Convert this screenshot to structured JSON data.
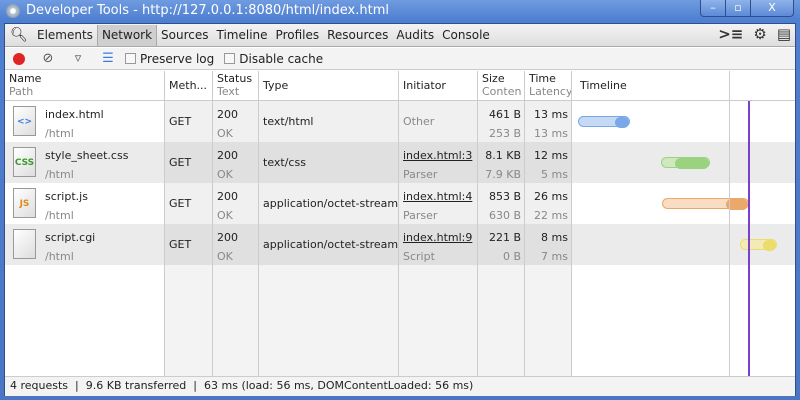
{
  "window": {
    "title": "Developer Tools - http://127.0.0.1:8080/html/index.html",
    "buttons": [
      "–",
      "▫",
      "X"
    ]
  },
  "tabs": [
    "Elements",
    "Network",
    "Sources",
    "Timeline",
    "Profiles",
    "Resources",
    "Audits",
    "Console"
  ],
  "selected_tab": "Network",
  "toolbar": {
    "preserve_log": "Preserve log",
    "disable_cache": "Disable cache",
    "preserve_log_checked": false,
    "disable_cache_checked": false
  },
  "columns": [
    {
      "title": "Name",
      "sub": "Path"
    },
    {
      "title": "Meth..."
    },
    {
      "title": "Status",
      "sub": "Text"
    },
    {
      "title": "Type"
    },
    {
      "title": "Initiator"
    },
    {
      "title": "Size",
      "sub": "Conten"
    },
    {
      "title": "Time",
      "sub": "Latency"
    },
    {
      "title": "Timeline"
    }
  ],
  "requests": [
    {
      "name": "index.html",
      "path": "/html",
      "icon": "html-file-icon",
      "icon_label": "<>",
      "method": "GET",
      "status": "200",
      "status_text": "OK",
      "type": "text/html",
      "initiator": "Other",
      "initiator_sub": "",
      "size": "461 B",
      "content": "253 B",
      "time": "13 ms",
      "latency": "13 ms"
    },
    {
      "name": "style_sheet.css",
      "path": "/html",
      "icon": "css-file-icon",
      "icon_label": "CSS",
      "method": "GET",
      "status": "200",
      "status_text": "OK",
      "type": "text/css",
      "initiator": "index.html:3",
      "initiator_sub": "Parser",
      "size": "8.1 KB",
      "content": "7.9 KB",
      "time": "12 ms",
      "latency": "5 ms"
    },
    {
      "name": "script.js",
      "path": "/html",
      "icon": "js-file-icon",
      "icon_label": "JS",
      "method": "GET",
      "status": "200",
      "status_text": "OK",
      "type": "application/octet-stream",
      "initiator": "index.html:4",
      "initiator_sub": "Parser",
      "size": "853 B",
      "content": "630 B",
      "time": "26 ms",
      "latency": "22 ms"
    },
    {
      "name": "script.cgi",
      "path": "/html",
      "icon": "generic-file-icon",
      "icon_label": "",
      "method": "GET",
      "status": "200",
      "status_text": "OK",
      "type": "application/octet-stream",
      "initiator": "index.html:9",
      "initiator_sub": "Script",
      "size": "221 B",
      "content": "0 B",
      "time": "8 ms",
      "latency": "7 ms"
    }
  ],
  "timeline_colors": [
    [
      "#c5d9f5",
      "#7aa7e8"
    ],
    [
      "#cfe8c0",
      "#9bd27f"
    ],
    [
      "#f8dcc4",
      "#eba86b"
    ],
    [
      "#f3eab8",
      "#ecdc6c"
    ]
  ],
  "load_marker_color": "#7b3fcf",
  "status": {
    "requests": "4 requests",
    "transferred": "9.6 KB transferred",
    "timing": "63 ms (load: 56 ms, DOMContentLoaded: 56 ms)",
    "sep": "|"
  }
}
